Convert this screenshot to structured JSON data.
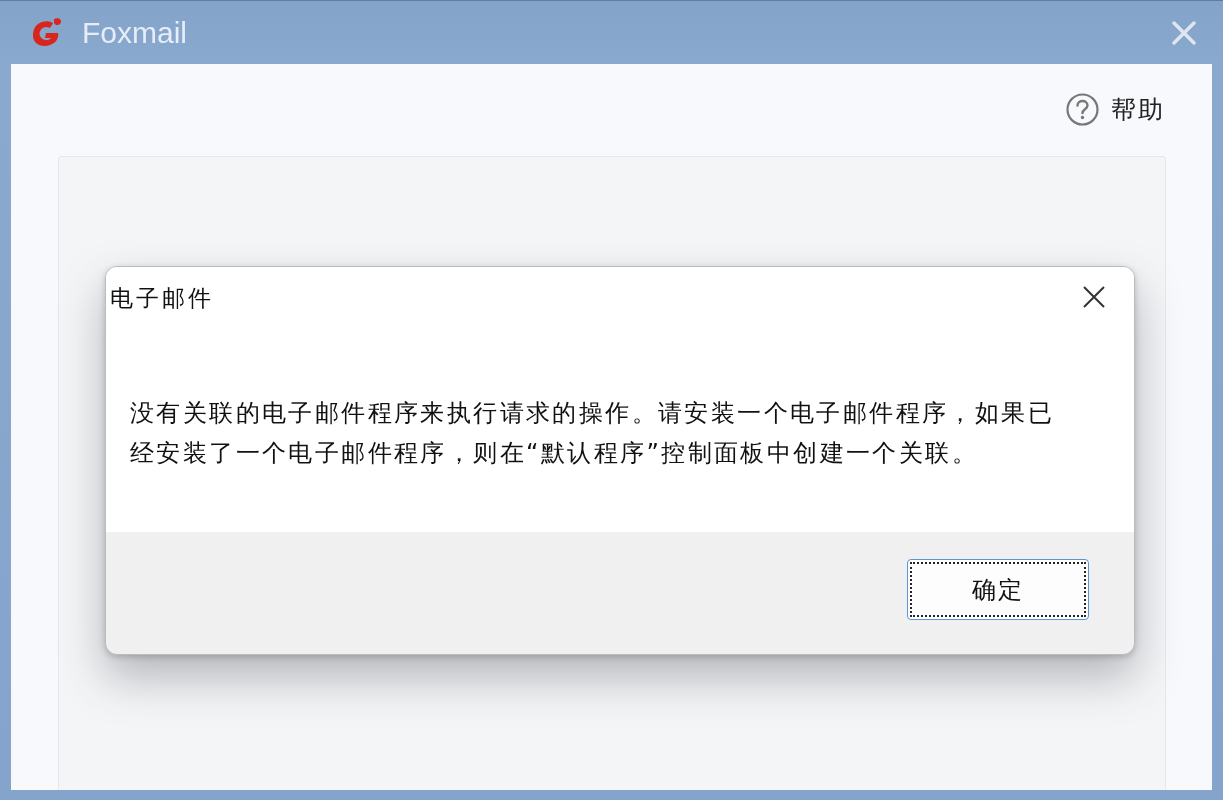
{
  "window": {
    "title": "Foxmail"
  },
  "help": {
    "label": "帮助"
  },
  "dialog": {
    "title": "电子邮件",
    "message": "没有关联的电子邮件程序来执行请求的操作。请安装一个电子邮件程序，如果已经安装了一个电子邮件程序，则在“默认程序”控制面板中创建一个关联。",
    "buttons": [
      {
        "label": "确定",
        "focused": true
      }
    ]
  }
}
